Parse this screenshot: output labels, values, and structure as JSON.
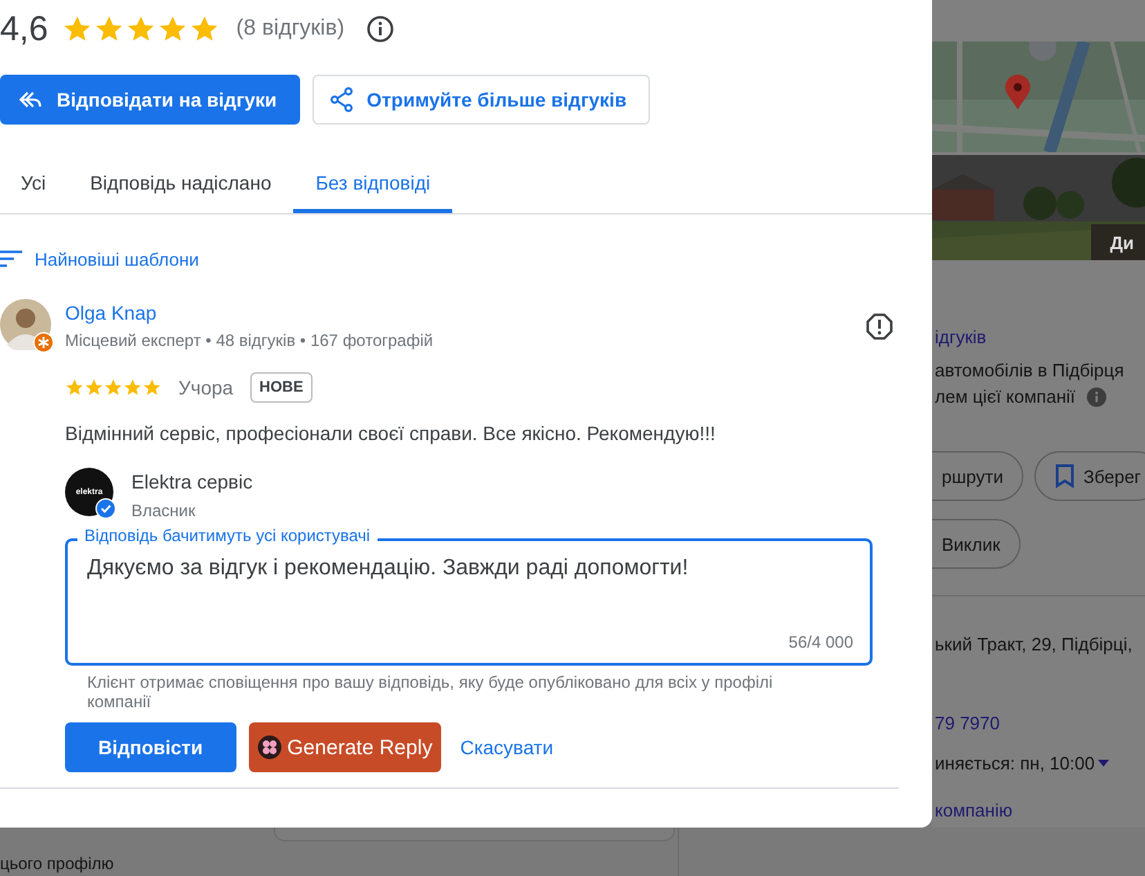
{
  "rating": {
    "value": "4,6",
    "stars": 5,
    "count": "(8 відгуків)"
  },
  "actions": [
    {
      "label": "Відповідати на відгуки",
      "kind": "primary"
    },
    {
      "label": "Отримуйте більше відгуків",
      "kind": "outline"
    }
  ],
  "tabs": [
    {
      "label": "Усі",
      "selected": false
    },
    {
      "label": "Відповідь надіслано",
      "selected": false
    },
    {
      "label": "Без відповіді",
      "selected": true
    }
  ],
  "sort": {
    "label": "Найновіші шаблони"
  },
  "review": {
    "author": "Olga Knap",
    "meta": "Місцевий експерт • 48 відгуків • 167 фотографій",
    "stars": 5,
    "date": "Учора",
    "badge": "НОВЕ",
    "text": "Відмінний сервіс, професіонали своєї справи. Все якісно. Рекомендую!!!"
  },
  "reply": {
    "owner": "Elektra сервіс",
    "role": "Власник",
    "logo": "elektra",
    "field_label": "Відповідь бачитимуть усі користувачі",
    "value": "Дякуємо за відгук і рекомендацію. Завжди раді допомогти!",
    "counter": "56/4 000",
    "hint": "Клієнт отримає сповіщення про вашу відповідь, яку буде опубліковано для всіх у профілі компанії",
    "buttons": [
      {
        "label": "Відповісти",
        "kind": "primary"
      },
      {
        "label": "Generate Reply",
        "kind": "generate"
      },
      {
        "label": "Скасувати",
        "kind": "text"
      }
    ]
  },
  "background_panel": {
    "photo_button": "Ди",
    "reviews_link": "ідгуків",
    "category": "автомобілів в Підбірця",
    "claim": "лем цієї компанії",
    "chip_rows": [
      [
        {
          "label": "ршрути",
          "kind": "plain"
        },
        {
          "label": "Зберег",
          "kind": "bookmark"
        }
      ],
      [
        {
          "label": "Виклик",
          "kind": "plain"
        }
      ]
    ],
    "address": "ький Тракт, 29, Підбірці,",
    "phone": "79 7970",
    "hours": "иняється: пн, 10:00",
    "manage_link": "компанію"
  },
  "bottom_text": "цього профілю"
}
